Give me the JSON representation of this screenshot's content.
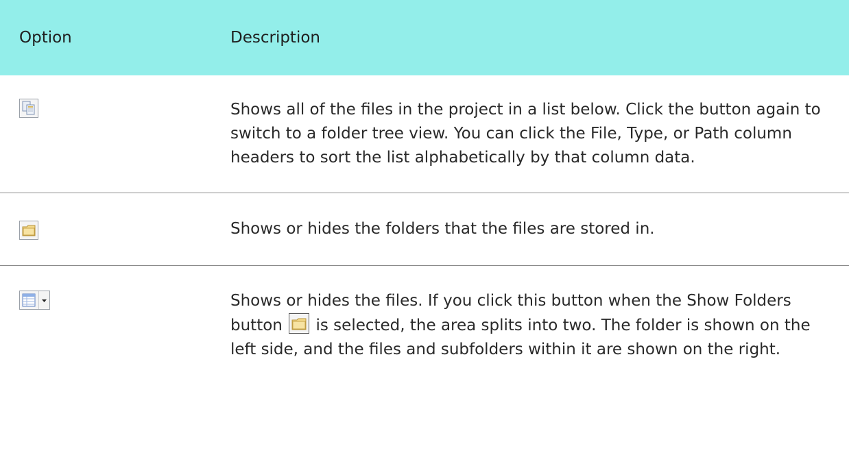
{
  "table": {
    "headers": {
      "option": "Option",
      "description": "Description"
    },
    "rows": [
      {
        "icon": "show-all-files-icon",
        "description": "Shows all of the files in the project in a list below. Click the button again to switch to a folder tree view. You can click the File, Type, or Path column headers to sort the list alphabetically by that column data."
      },
      {
        "icon": "show-folders-icon",
        "description": "Shows or hides the folders that the files are stored in."
      },
      {
        "icon": "show-files-icon",
        "description_before": "Shows or hides the files. If you click this button when the Show Folders button",
        "inline_icon": "folder-icon",
        "description_after": "is selected, the area splits into two. The folder is shown on the left side, and the files and subfolders within it are shown on the right."
      }
    ]
  },
  "colors": {
    "header_background": "#93eeea",
    "row_divider": "#8a8a8a",
    "text": "#2a2a2a"
  }
}
